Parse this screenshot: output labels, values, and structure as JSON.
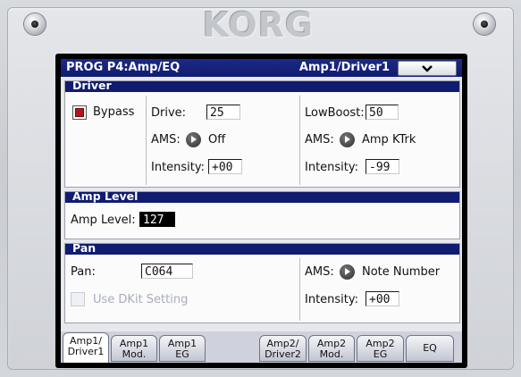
{
  "hardware": {
    "brand": "KORG"
  },
  "title_bar": {
    "page_title": "PROG P4:Amp/EQ",
    "page_subtitle": "Amp1/Driver1",
    "menu_icon": "chevron-down-icon"
  },
  "driver": {
    "header": "Driver",
    "bypass_label": "Bypass",
    "bypass_checked": true,
    "drive_label": "Drive:",
    "drive_value": "25",
    "ams1_label": "AMS:",
    "ams1_value": "Off",
    "intensity1_label": "Intensity:",
    "intensity1_value": "+00",
    "lowboost_label": "LowBoost:",
    "lowboost_value": "50",
    "ams2_label": "AMS:",
    "ams2_value": "Amp KTrk",
    "intensity2_label": "Intensity:",
    "intensity2_value": "-99"
  },
  "amp_level": {
    "header": "Amp Level",
    "label": "Amp Level:",
    "value": "127"
  },
  "pan": {
    "header": "Pan",
    "pan_label": "Pan:",
    "pan_value": "C064",
    "dkit_label": "Use DKit Setting",
    "dkit_checked": false,
    "ams_label": "AMS:",
    "ams_value": "Note Number",
    "intensity_label": "Intensity:",
    "intensity_value": "+00"
  },
  "tabs": [
    {
      "line1": "Amp1/",
      "line2": "Driver1",
      "active": true
    },
    {
      "line1": "Amp1",
      "line2": "Mod.",
      "active": false
    },
    {
      "line1": "Amp1",
      "line2": "EG",
      "active": false
    },
    {
      "line1": "Amp2/",
      "line2": "Driver2",
      "active": false
    },
    {
      "line1": "Amp2",
      "line2": "Mod.",
      "active": false
    },
    {
      "line1": "Amp2",
      "line2": "EG",
      "active": false
    },
    {
      "line1": "EQ",
      "line2": "",
      "active": false
    }
  ],
  "colors": {
    "header_blue": "#101c70",
    "checkbox_red": "#b0161c",
    "lcd_background": "#e7e8ec"
  }
}
